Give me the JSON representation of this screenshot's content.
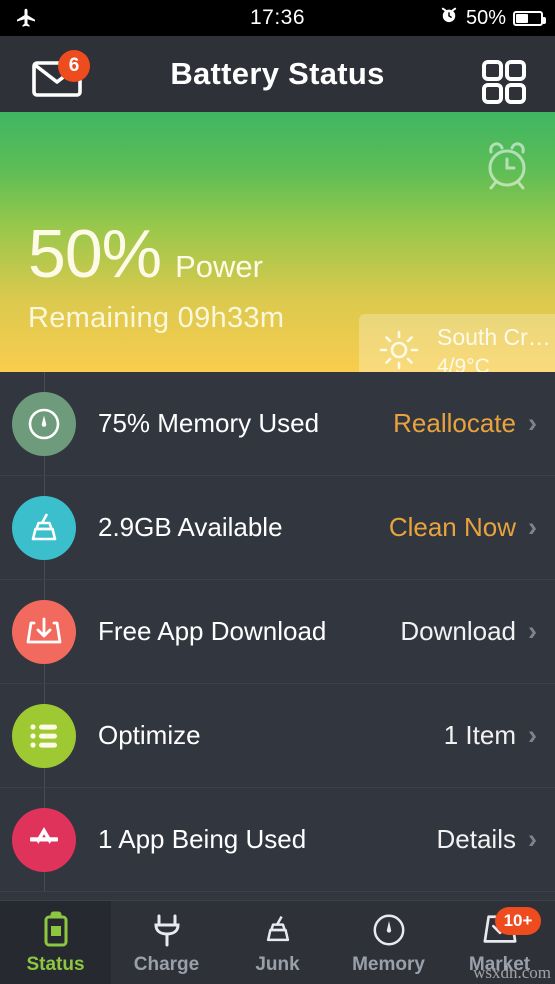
{
  "status_bar": {
    "airplane_icon": "airplane-mode-icon",
    "time": "17:36",
    "alarm_icon": "alarm-clock-icon",
    "battery_percent": "50%",
    "battery_icon": "battery-icon"
  },
  "header": {
    "title": "Battery Status",
    "mail_icon": "envelope-icon",
    "mail_badge": "6",
    "grid_icon": "grid-menu-icon"
  },
  "hero": {
    "alarm_icon": "alarm-clock-icon",
    "percent": "50%",
    "percent_word": "Power",
    "remaining": "Remaining 09h33m",
    "weather": {
      "icon": "sun-icon",
      "city": "South Cr…",
      "temperature": "4/9°C"
    },
    "gradient_top": "#3fb662",
    "gradient_bottom": "#f9cd4e"
  },
  "list": {
    "rows": [
      {
        "icon": "gauge-icon",
        "icon_color": "#6d9b7c",
        "label": "75% Memory Used",
        "action": "Reallocate",
        "action_style": "accent",
        "chevron": "›"
      },
      {
        "icon": "broom-icon",
        "icon_color": "#3bbfcc",
        "label": "2.9GB Available",
        "action": "Clean Now",
        "action_style": "accent",
        "chevron": "›"
      },
      {
        "icon": "download-tray-icon",
        "icon_color": "#f26a5e",
        "label": "Free App Download",
        "action": "Download",
        "action_style": "plain",
        "chevron": "›"
      },
      {
        "icon": "bullet-list-icon",
        "icon_color": "#9fc932",
        "label": "Optimize",
        "action": "1 Item",
        "action_style": "plain",
        "chevron": "›"
      },
      {
        "icon": "app-store-icon",
        "icon_color": "#e0335c",
        "label": "1 App Being Used",
        "action": "Details",
        "action_style": "plain",
        "chevron": "›"
      }
    ]
  },
  "tabbar": {
    "active_color": "#8dc63f",
    "items": [
      {
        "label": "Status",
        "icon": "battery-icon",
        "active": true
      },
      {
        "label": "Charge",
        "icon": "plug-icon",
        "active": false
      },
      {
        "label": "Junk",
        "icon": "broom-icon",
        "active": false
      },
      {
        "label": "Memory",
        "icon": "gauge-icon",
        "active": false
      },
      {
        "label": "Market",
        "icon": "inbox-tray-icon",
        "active": false,
        "badge": "10+"
      }
    ]
  },
  "watermark": "wsxdn.com"
}
